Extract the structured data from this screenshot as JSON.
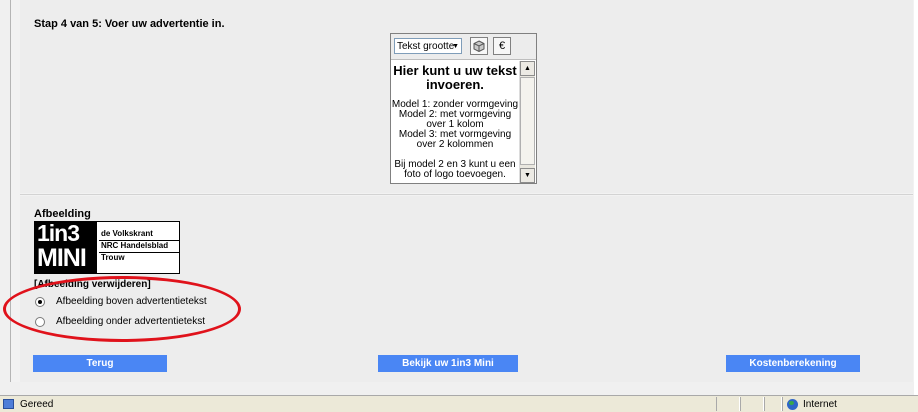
{
  "step_title": "Stap 4 van 5: Voer uw advertentie in.",
  "editor": {
    "text_size_label": "Tekst grootte",
    "toolbar_icons": [
      "image-icon",
      "euro-icon"
    ],
    "euro_symbol": "€",
    "heading": "Hier kunt u uw tekst\ninvoeren.",
    "models": "Model 1: zonder vormgeving\nModel 2: met vormgeving\nover 1 kolom\nModel 3: met vormgeving\nover 2 kolommen",
    "note": "Bij model 2 en 3 kunt u een\nfoto of logo toevoegen."
  },
  "image_section": {
    "title": "Afbeelding",
    "logo": {
      "line1": "1in3",
      "line2": "MINI",
      "papers": [
        "de Volkskrant",
        "NRC Handelsblad",
        "Trouw"
      ]
    },
    "remove_link": "[Afbeelding verwijderen]",
    "options": [
      {
        "label": "Afbeelding boven advertentietekst",
        "selected": true
      },
      {
        "label": "Afbeelding onder advertentietekst",
        "selected": false
      }
    ]
  },
  "buttons": {
    "back": "Terug",
    "preview": "Bekijk uw 1in3 Mini",
    "cost": "Kostenberekening"
  },
  "statusbar": {
    "status": "Gereed",
    "zone": "Internet"
  },
  "colors": {
    "button_bg": "#4a86f4",
    "highlight_oval": "#e0121b"
  }
}
